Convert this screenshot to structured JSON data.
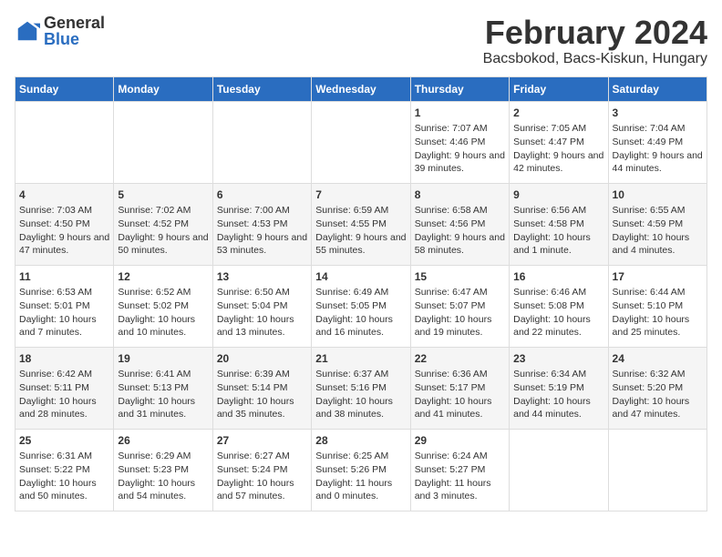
{
  "header": {
    "logo_general": "General",
    "logo_blue": "Blue",
    "month_title": "February 2024",
    "location": "Bacsbokod, Bacs-Kiskun, Hungary"
  },
  "weekdays": [
    "Sunday",
    "Monday",
    "Tuesday",
    "Wednesday",
    "Thursday",
    "Friday",
    "Saturday"
  ],
  "weeks": [
    [
      {
        "day": "",
        "sunrise": "",
        "sunset": "",
        "daylight": ""
      },
      {
        "day": "",
        "sunrise": "",
        "sunset": "",
        "daylight": ""
      },
      {
        "day": "",
        "sunrise": "",
        "sunset": "",
        "daylight": ""
      },
      {
        "day": "",
        "sunrise": "",
        "sunset": "",
        "daylight": ""
      },
      {
        "day": "1",
        "sunrise": "Sunrise: 7:07 AM",
        "sunset": "Sunset: 4:46 PM",
        "daylight": "Daylight: 9 hours and 39 minutes."
      },
      {
        "day": "2",
        "sunrise": "Sunrise: 7:05 AM",
        "sunset": "Sunset: 4:47 PM",
        "daylight": "Daylight: 9 hours and 42 minutes."
      },
      {
        "day": "3",
        "sunrise": "Sunrise: 7:04 AM",
        "sunset": "Sunset: 4:49 PM",
        "daylight": "Daylight: 9 hours and 44 minutes."
      }
    ],
    [
      {
        "day": "4",
        "sunrise": "Sunrise: 7:03 AM",
        "sunset": "Sunset: 4:50 PM",
        "daylight": "Daylight: 9 hours and 47 minutes."
      },
      {
        "day": "5",
        "sunrise": "Sunrise: 7:02 AM",
        "sunset": "Sunset: 4:52 PM",
        "daylight": "Daylight: 9 hours and 50 minutes."
      },
      {
        "day": "6",
        "sunrise": "Sunrise: 7:00 AM",
        "sunset": "Sunset: 4:53 PM",
        "daylight": "Daylight: 9 hours and 53 minutes."
      },
      {
        "day": "7",
        "sunrise": "Sunrise: 6:59 AM",
        "sunset": "Sunset: 4:55 PM",
        "daylight": "Daylight: 9 hours and 55 minutes."
      },
      {
        "day": "8",
        "sunrise": "Sunrise: 6:58 AM",
        "sunset": "Sunset: 4:56 PM",
        "daylight": "Daylight: 9 hours and 58 minutes."
      },
      {
        "day": "9",
        "sunrise": "Sunrise: 6:56 AM",
        "sunset": "Sunset: 4:58 PM",
        "daylight": "Daylight: 10 hours and 1 minute."
      },
      {
        "day": "10",
        "sunrise": "Sunrise: 6:55 AM",
        "sunset": "Sunset: 4:59 PM",
        "daylight": "Daylight: 10 hours and 4 minutes."
      }
    ],
    [
      {
        "day": "11",
        "sunrise": "Sunrise: 6:53 AM",
        "sunset": "Sunset: 5:01 PM",
        "daylight": "Daylight: 10 hours and 7 minutes."
      },
      {
        "day": "12",
        "sunrise": "Sunrise: 6:52 AM",
        "sunset": "Sunset: 5:02 PM",
        "daylight": "Daylight: 10 hours and 10 minutes."
      },
      {
        "day": "13",
        "sunrise": "Sunrise: 6:50 AM",
        "sunset": "Sunset: 5:04 PM",
        "daylight": "Daylight: 10 hours and 13 minutes."
      },
      {
        "day": "14",
        "sunrise": "Sunrise: 6:49 AM",
        "sunset": "Sunset: 5:05 PM",
        "daylight": "Daylight: 10 hours and 16 minutes."
      },
      {
        "day": "15",
        "sunrise": "Sunrise: 6:47 AM",
        "sunset": "Sunset: 5:07 PM",
        "daylight": "Daylight: 10 hours and 19 minutes."
      },
      {
        "day": "16",
        "sunrise": "Sunrise: 6:46 AM",
        "sunset": "Sunset: 5:08 PM",
        "daylight": "Daylight: 10 hours and 22 minutes."
      },
      {
        "day": "17",
        "sunrise": "Sunrise: 6:44 AM",
        "sunset": "Sunset: 5:10 PM",
        "daylight": "Daylight: 10 hours and 25 minutes."
      }
    ],
    [
      {
        "day": "18",
        "sunrise": "Sunrise: 6:42 AM",
        "sunset": "Sunset: 5:11 PM",
        "daylight": "Daylight: 10 hours and 28 minutes."
      },
      {
        "day": "19",
        "sunrise": "Sunrise: 6:41 AM",
        "sunset": "Sunset: 5:13 PM",
        "daylight": "Daylight: 10 hours and 31 minutes."
      },
      {
        "day": "20",
        "sunrise": "Sunrise: 6:39 AM",
        "sunset": "Sunset: 5:14 PM",
        "daylight": "Daylight: 10 hours and 35 minutes."
      },
      {
        "day": "21",
        "sunrise": "Sunrise: 6:37 AM",
        "sunset": "Sunset: 5:16 PM",
        "daylight": "Daylight: 10 hours and 38 minutes."
      },
      {
        "day": "22",
        "sunrise": "Sunrise: 6:36 AM",
        "sunset": "Sunset: 5:17 PM",
        "daylight": "Daylight: 10 hours and 41 minutes."
      },
      {
        "day": "23",
        "sunrise": "Sunrise: 6:34 AM",
        "sunset": "Sunset: 5:19 PM",
        "daylight": "Daylight: 10 hours and 44 minutes."
      },
      {
        "day": "24",
        "sunrise": "Sunrise: 6:32 AM",
        "sunset": "Sunset: 5:20 PM",
        "daylight": "Daylight: 10 hours and 47 minutes."
      }
    ],
    [
      {
        "day": "25",
        "sunrise": "Sunrise: 6:31 AM",
        "sunset": "Sunset: 5:22 PM",
        "daylight": "Daylight: 10 hours and 50 minutes."
      },
      {
        "day": "26",
        "sunrise": "Sunrise: 6:29 AM",
        "sunset": "Sunset: 5:23 PM",
        "daylight": "Daylight: 10 hours and 54 minutes."
      },
      {
        "day": "27",
        "sunrise": "Sunrise: 6:27 AM",
        "sunset": "Sunset: 5:24 PM",
        "daylight": "Daylight: 10 hours and 57 minutes."
      },
      {
        "day": "28",
        "sunrise": "Sunrise: 6:25 AM",
        "sunset": "Sunset: 5:26 PM",
        "daylight": "Daylight: 11 hours and 0 minutes."
      },
      {
        "day": "29",
        "sunrise": "Sunrise: 6:24 AM",
        "sunset": "Sunset: 5:27 PM",
        "daylight": "Daylight: 11 hours and 3 minutes."
      },
      {
        "day": "",
        "sunrise": "",
        "sunset": "",
        "daylight": ""
      },
      {
        "day": "",
        "sunrise": "",
        "sunset": "",
        "daylight": ""
      }
    ]
  ]
}
